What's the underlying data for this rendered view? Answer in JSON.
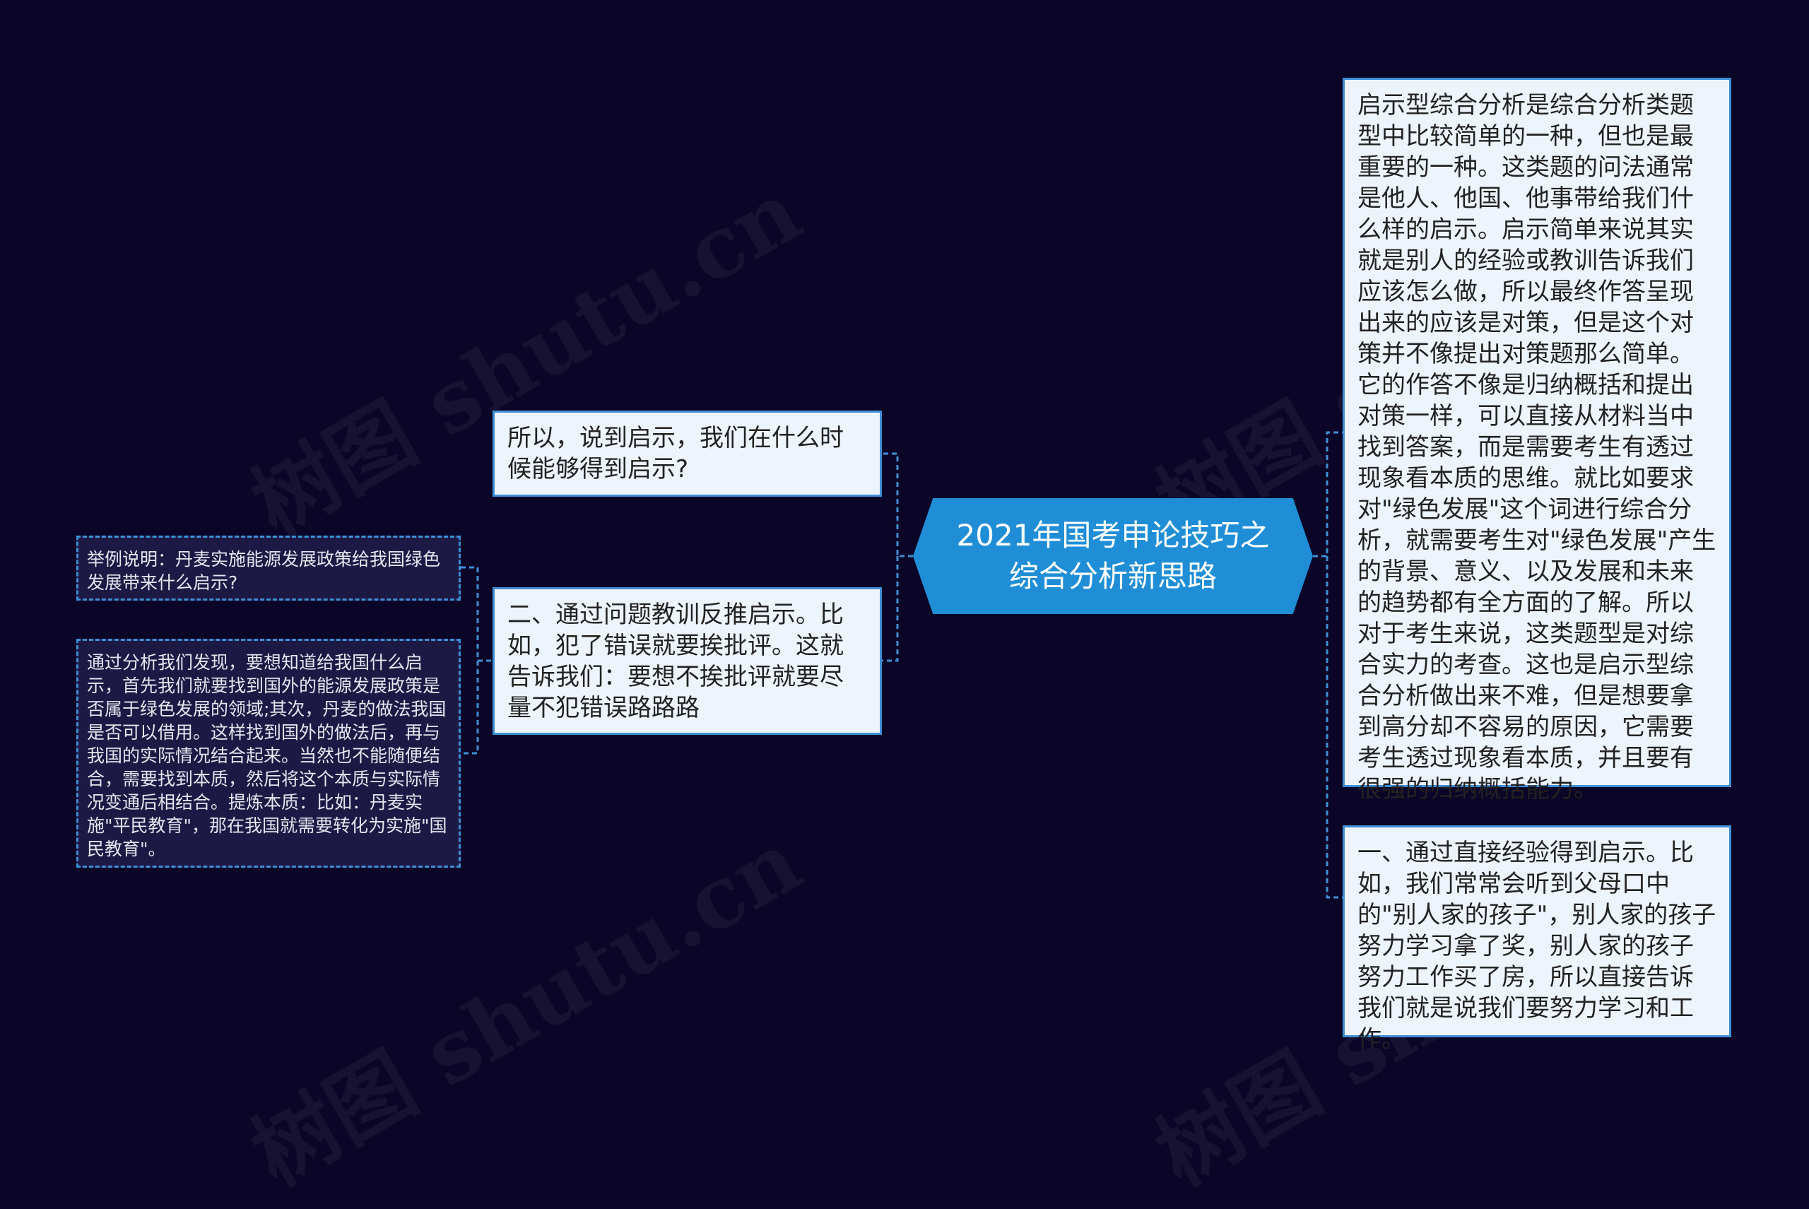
{
  "watermarks": [
    {
      "text": "树图 shutu.cn"
    },
    {
      "text": "树图 shutu.cn"
    },
    {
      "text": "树图 shutu.cn"
    },
    {
      "text": "树图 shutu.cn"
    }
  ],
  "root": {
    "text": "2021年国考申论技巧之综合分析新思路"
  },
  "right_nodes": [
    {
      "text": "启示型综合分析是综合分析类题型中比较简单的一种，但也是最重要的一种。这类题的问法通常是他人、他国、他事带给我们什么样的启示。启示简单来说其实就是别人的经验或教训告诉我们应该怎么做，所以最终作答呈现出来的应该是对策，但是这个对策并不像提出对策题那么简单。它的作答不像是归纳概括和提出对策一样，可以直接从材料当中找到答案，而是需要考生有透过现象看本质的思维。就比如要求对\"绿色发展\"这个词进行综合分析，就需要考生对\"绿色发展\"产生的背景、意义、以及发展和未来的趋势都有全方面的了解。所以对于考生来说，这类题型是对综合实力的考查。这也是启示型综合分析做出来不难，但是想要拿到高分却不容易的原因，它需要考生透过现象看本质，并且要有很强的归纳概括能力。"
    },
    {
      "text": "一、通过直接经验得到启示。比如，我们常常会听到父母口中的\"别人家的孩子\"，别人家的孩子努力学习拿了奖，别人家的孩子努力工作买了房，所以直接告诉我们就是说我们要努力学习和工作。"
    }
  ],
  "left_nodes": [
    {
      "text": "所以，说到启示，我们在什么时候能够得到启示?"
    },
    {
      "text": "二、通过问题教训反推启示。比如，犯了错误就要挨批评。这就告诉我们：要想不挨批评就要尽量不犯错误路路路"
    }
  ],
  "leaf_nodes": [
    {
      "text": "举例说明：丹麦实施能源发展政策给我国绿色发展带来什么启示?"
    },
    {
      "text": "通过分析我们发现，要想知道给我国什么启示，首先我们就要找到国外的能源发展政策是否属于绿色发展的领域;其次，丹麦的做法我国是否可以借用。这样找到国外的做法后，再与我国的实际情况结合起来。当然也不能随便结合，需要找到本质，然后将这个本质与实际情况变通后相结合。提炼本质：比如：丹麦实施\"平民教育\"，那在我国就需要转化为实施\"国民教育\"。"
    }
  ],
  "colors": {
    "background": "#0b0628",
    "root_fill": "#1f8ed6",
    "connector": "#3f8fd6",
    "light_node_fill": "#eef4fb",
    "dark_node_fill": "#1c1a45"
  }
}
